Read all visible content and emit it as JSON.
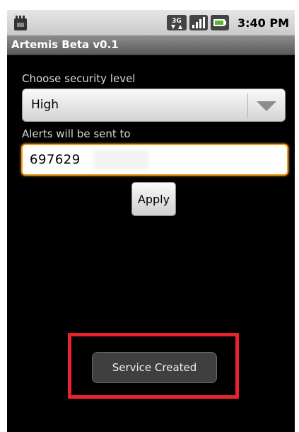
{
  "status_bar": {
    "left_icon": "sd-card-icon",
    "network_badge": "3G",
    "signal_icon": "signal-bars-icon",
    "battery_icon": "battery-icon",
    "time": "3:40 PM"
  },
  "app": {
    "title": "Artemis Beta v0.1"
  },
  "security": {
    "label": "Choose security level",
    "selected": "High",
    "dropdown_icon": "chevron-down-icon"
  },
  "alerts": {
    "label": "Alerts will be sent to",
    "value": "697629"
  },
  "apply_button": {
    "label": "Apply"
  },
  "toast": {
    "message": "Service Created"
  },
  "colors": {
    "background": "#000000",
    "input_focus": "#f09a18",
    "highlight": "#e8232b"
  }
}
